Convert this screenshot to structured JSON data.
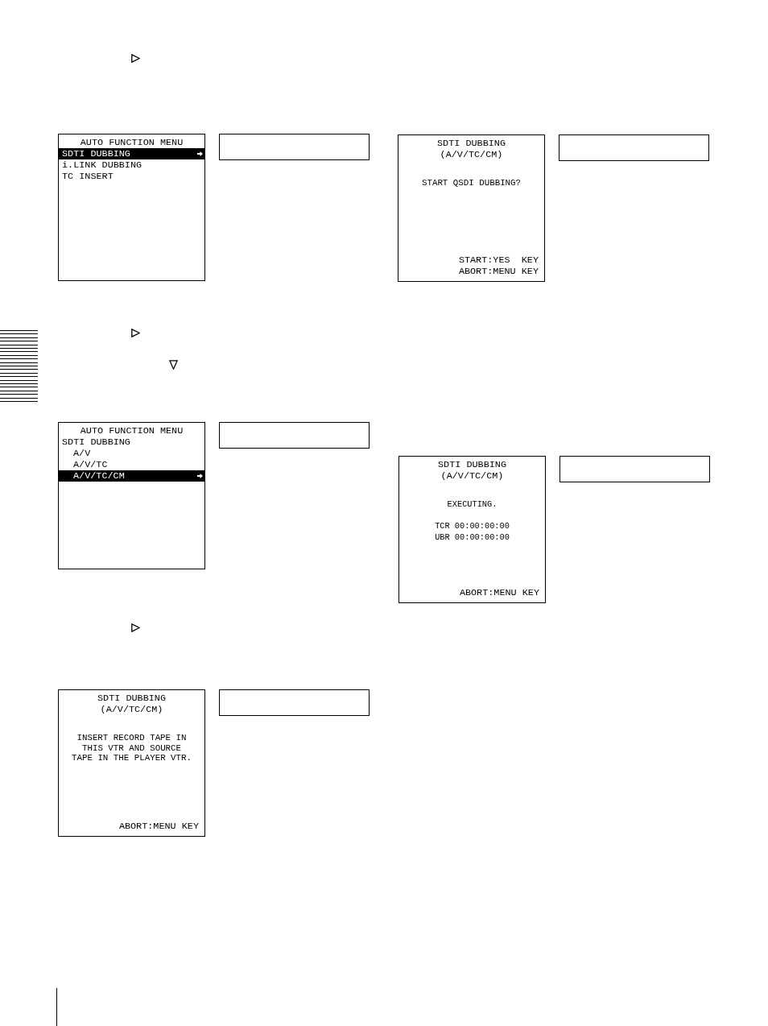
{
  "left_column": {
    "screens": [
      {
        "kind": "menu",
        "title": "AUTO FUNCTION MENU",
        "items": [
          {
            "label": "SDTI DUBBING",
            "selected": true
          },
          {
            "label": "i.LINK DUBBING",
            "selected": false
          },
          {
            "label": "TC INSERT",
            "selected": false
          }
        ]
      },
      {
        "kind": "menu",
        "title": "AUTO FUNCTION MENU",
        "items": [
          {
            "label": "SDTI DUBBING",
            "selected": false,
            "children": [
              {
                "label": "A/V",
                "selected": false
              },
              {
                "label": "A/V/TC",
                "selected": false
              },
              {
                "label": "A/V/TC/CM",
                "selected": true
              }
            ]
          }
        ]
      },
      {
        "kind": "message",
        "title": "SDTI DUBBING",
        "subtitle": "(A/V/TC/CM)",
        "message": "INSERT RECORD TAPE IN\nTHIS VTR AND SOURCE\nTAPE IN THE PLAYER VTR.",
        "footer": [
          "ABORT:MENU KEY"
        ]
      }
    ]
  },
  "right_column": {
    "screens": [
      {
        "kind": "message",
        "title": "SDTI DUBBING",
        "subtitle": "(A/V/TC/CM)",
        "message": "START QSDI DUBBING?",
        "footer": [
          "START:YES  KEY",
          "ABORT:MENU KEY"
        ]
      },
      {
        "kind": "message",
        "title": "SDTI DUBBING",
        "subtitle": "(A/V/TC/CM)",
        "status": "EXECUTING.",
        "readouts": [
          "TCR 00:00:00:00",
          "UBR 00:00:00:00"
        ],
        "footer": [
          "ABORT:MENU KEY"
        ]
      }
    ]
  }
}
